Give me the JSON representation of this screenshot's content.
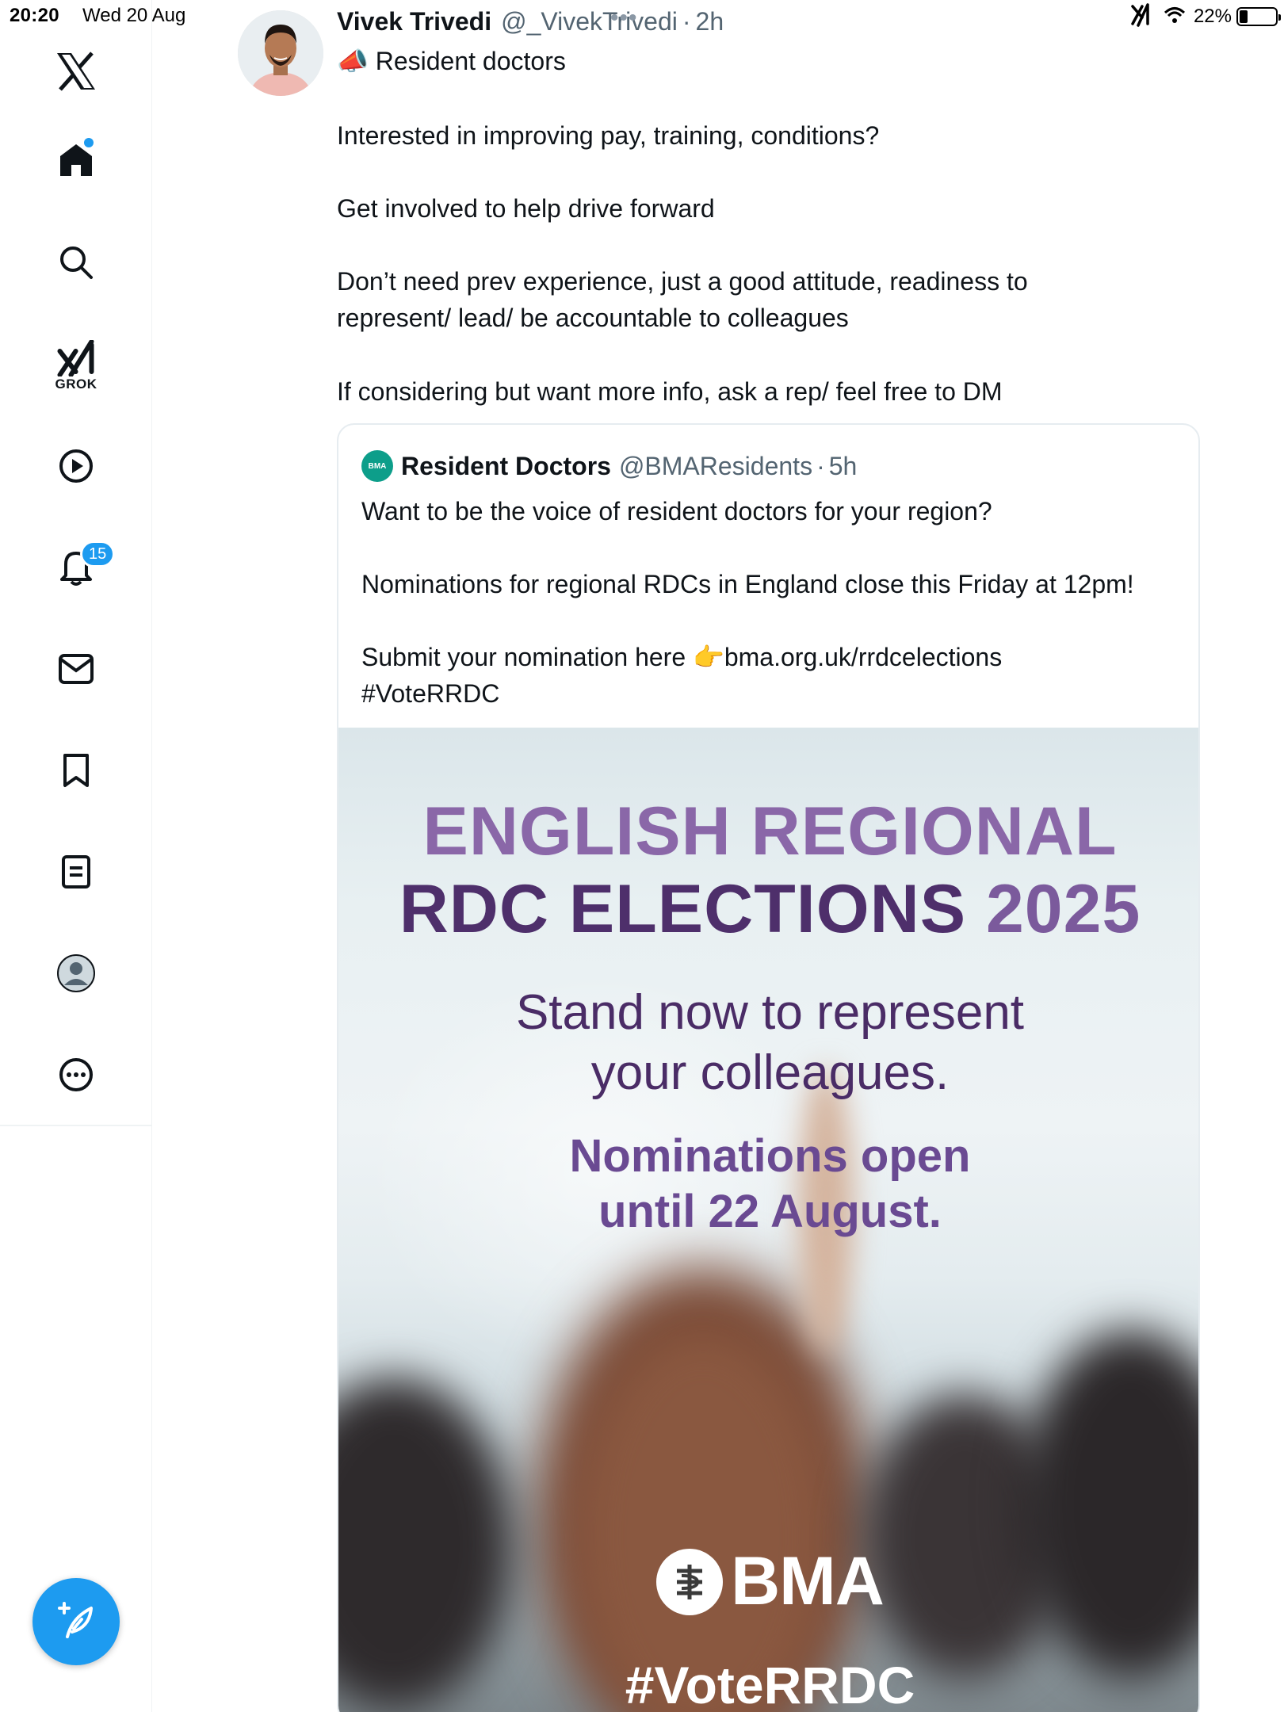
{
  "status_bar": {
    "time": "20:20",
    "date": "Wed 20 Aug",
    "battery_pct": "22%",
    "battery_level": 0.22
  },
  "sidebar": {
    "grok_label": "GROK",
    "notifications_badge": "15",
    "items": [
      {
        "name": "home",
        "icon": "home-icon"
      },
      {
        "name": "explore",
        "icon": "search-icon"
      },
      {
        "name": "grok",
        "icon": "grok-icon"
      },
      {
        "name": "video",
        "icon": "play-icon"
      },
      {
        "name": "notifications",
        "icon": "bell-icon"
      },
      {
        "name": "messages",
        "icon": "mail-icon"
      },
      {
        "name": "bookmarks",
        "icon": "bookmark-icon"
      },
      {
        "name": "lists",
        "icon": "list-icon"
      },
      {
        "name": "profile",
        "icon": "profile-icon"
      },
      {
        "name": "more",
        "icon": "more-icon"
      }
    ],
    "compose": {
      "icon": "compose-icon"
    }
  },
  "tweet": {
    "author_name": "Vivek Trivedi",
    "author_handle": "@_VivekTrivedi",
    "separator": "·",
    "time": "2h",
    "lines": [
      "Resident doctors",
      "Interested in improving pay, training, conditions?",
      "Get involved to help drive forward",
      "Don’t need prev experience, just a good attitude, readiness to",
      "represent/ lead/ be accountable to colleagues",
      "If considering but want more info, ask a rep/ feel free to DM"
    ],
    "emoji": "📣"
  },
  "quote": {
    "avatar_text": "BMA",
    "name": "Resident Doctors",
    "handle": "@BMAResidents",
    "separator": "·",
    "time": "5h",
    "lines": [
      "Want to be the voice of resident doctors for your region?",
      "Nominations for regional RDCs in England close this Friday at 12pm!",
      "Submit your nomination here 👉bma.org.uk/rrdcelections",
      "#VoteRRDC"
    ]
  },
  "poster": {
    "title_line1": "ENGLISH REGIONAL",
    "title_line2": "RDC ELECTIONS ",
    "title_year": "2025",
    "sub_line1": "Stand now to represent",
    "sub_line2": "your colleagues.",
    "nom_line1": "Nominations open",
    "nom_line2": "until 22 August.",
    "logo_text": "BMA",
    "hashtag": "#VoteRRDC"
  },
  "colors": {
    "accent": "#1d9bf0",
    "poster_purple_light": "#8a67a8",
    "poster_purple_dark": "#4e2f6b"
  }
}
